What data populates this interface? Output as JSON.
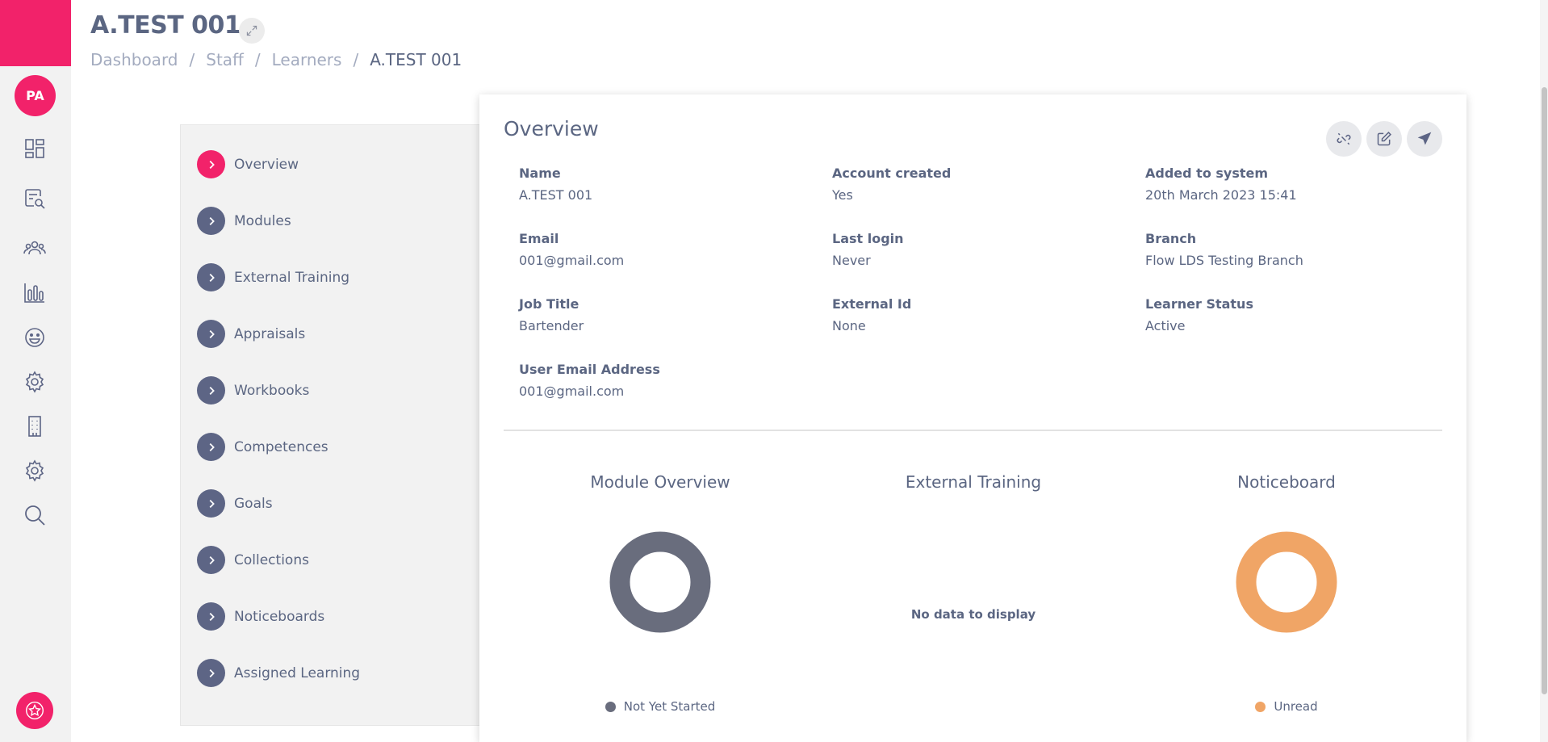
{
  "rail": {
    "avatar_initials": "PA",
    "items": [
      {
        "icon": "dashboard-icon"
      },
      {
        "icon": "search-document-icon"
      },
      {
        "icon": "users-icon"
      },
      {
        "icon": "bar-chart-icon"
      },
      {
        "icon": "smiley-icon"
      },
      {
        "icon": "gear-icon"
      },
      {
        "icon": "building-icon"
      },
      {
        "icon": "gear-icon"
      },
      {
        "icon": "search-icon"
      }
    ],
    "bottom_icon": "star-badge-icon"
  },
  "header": {
    "title": "A.TEST 001",
    "breadcrumb": [
      "Dashboard",
      "Staff",
      "Learners",
      "A.TEST 001"
    ],
    "separator": "/"
  },
  "sidemenu": {
    "items": [
      {
        "label": "Overview",
        "active": true
      },
      {
        "label": "Modules"
      },
      {
        "label": "External Training"
      },
      {
        "label": "Appraisals"
      },
      {
        "label": "Workbooks"
      },
      {
        "label": "Competences"
      },
      {
        "label": "Goals"
      },
      {
        "label": "Collections"
      },
      {
        "label": "Noticeboards"
      },
      {
        "label": "Assigned Learning"
      }
    ]
  },
  "overview": {
    "title": "Overview",
    "actions": [
      "unlink-icon",
      "edit-icon",
      "send-icon"
    ],
    "fields": [
      {
        "label": "Name",
        "value": "A.TEST 001"
      },
      {
        "label": "Account created",
        "value": "Yes"
      },
      {
        "label": "Added to system",
        "value": "20th March 2023 15:41"
      },
      {
        "label": "Email",
        "value": "001@gmail.com"
      },
      {
        "label": "Last login",
        "value": "Never"
      },
      {
        "label": "Branch",
        "value": "Flow LDS Testing Branch"
      },
      {
        "label": "Job Title",
        "value": "Bartender"
      },
      {
        "label": "External Id",
        "value": "None"
      },
      {
        "label": "Learner Status",
        "value": "Active"
      },
      {
        "label": "User Email Address",
        "value": "001@gmail.com"
      }
    ]
  },
  "widgets": {
    "module_overview": {
      "title": "Module Overview",
      "legend": "Not Yet Started",
      "color": "#696d7d"
    },
    "external_training": {
      "title": "External Training",
      "empty_text": "No data to display"
    },
    "noticeboard": {
      "title": "Noticeboard",
      "legend": "Unread",
      "color": "#f0a566"
    }
  },
  "colors": {
    "accent": "#f2226a",
    "menu_chevron": "#5d6585",
    "text": "#5b6682",
    "muted": "#a3abbf"
  }
}
